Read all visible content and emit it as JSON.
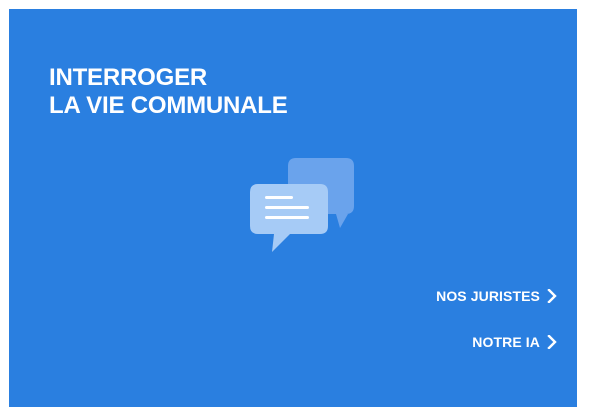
{
  "card": {
    "background_color": "#2a7fe0",
    "title_lines": [
      "INTERROGER",
      "LA VIE COMMUNALE"
    ],
    "icon": "chat-bubbles-icon"
  },
  "links": [
    {
      "label": "NOS JURISTES",
      "icon": "chevron-right-icon"
    },
    {
      "label": "NOTRE IA",
      "icon": "chevron-right-icon"
    }
  ]
}
